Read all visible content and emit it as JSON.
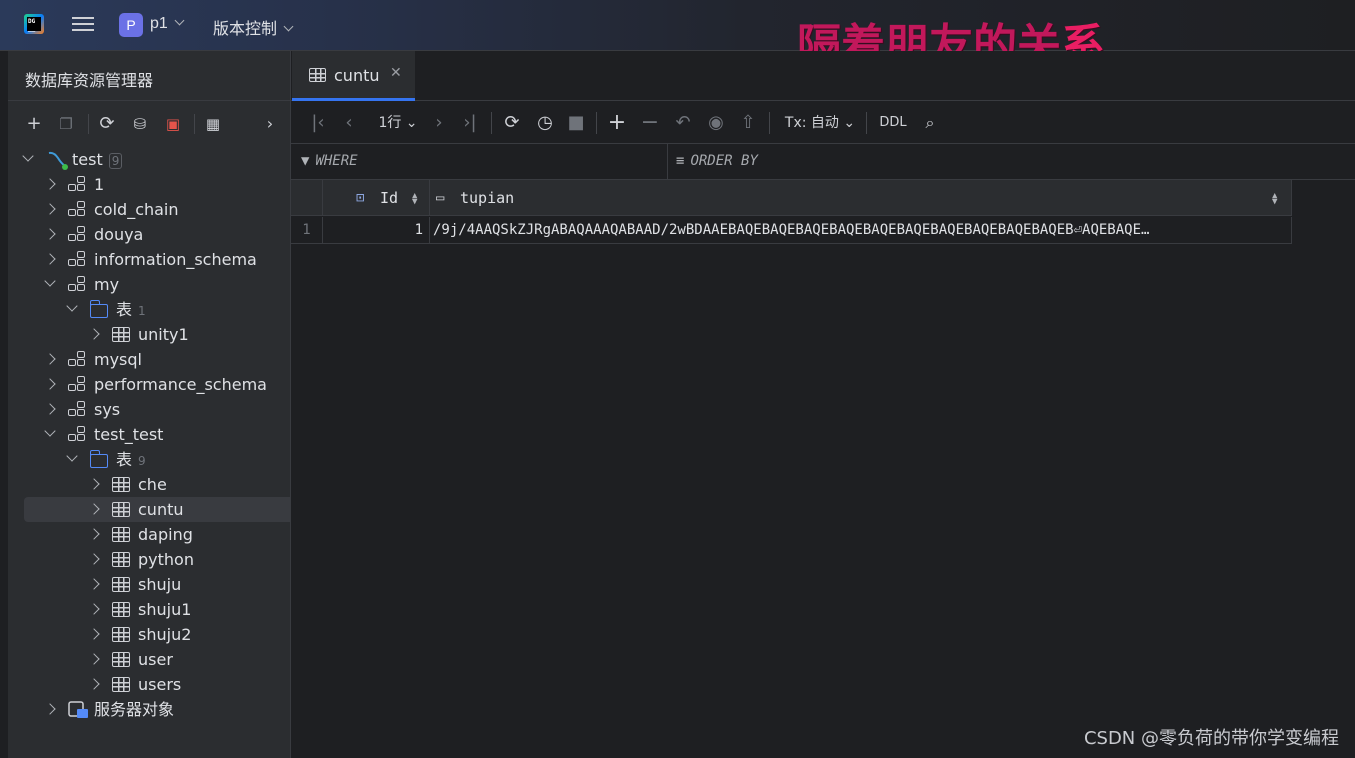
{
  "titlebar": {
    "project_badge": "P",
    "project_name": "p1",
    "vcs_label": "版本控制",
    "overlay_text_main": "隔着朋友的关",
    "overlay_text_last": "系"
  },
  "left_panel": {
    "title": "数据库资源管理器",
    "tree": [
      {
        "label": "test",
        "count": "9",
        "level": 0,
        "expanded": true,
        "icon": "datasource-icon"
      },
      {
        "label": "1",
        "level": 1,
        "expanded": false,
        "icon": "schema-icon"
      },
      {
        "label": "cold_chain",
        "level": 1,
        "expanded": false,
        "icon": "schema-icon"
      },
      {
        "label": "douya",
        "level": 1,
        "expanded": false,
        "icon": "schema-icon"
      },
      {
        "label": "information_schema",
        "level": 1,
        "expanded": false,
        "icon": "schema-icon"
      },
      {
        "label": "my",
        "level": 1,
        "expanded": true,
        "icon": "schema-icon"
      },
      {
        "label": "表",
        "count": "1",
        "level": 2,
        "expanded": true,
        "icon": "folder-icon"
      },
      {
        "label": "unity1",
        "level": 3,
        "expanded": false,
        "icon": "table-icon"
      },
      {
        "label": "mysql",
        "level": 1,
        "expanded": false,
        "icon": "schema-icon"
      },
      {
        "label": "performance_schema",
        "level": 1,
        "expanded": false,
        "icon": "schema-icon"
      },
      {
        "label": "sys",
        "level": 1,
        "expanded": false,
        "icon": "schema-icon"
      },
      {
        "label": "test_test",
        "level": 1,
        "expanded": true,
        "icon": "schema-icon"
      },
      {
        "label": "表",
        "count": "9",
        "level": 2,
        "expanded": true,
        "icon": "folder-icon"
      },
      {
        "label": "che",
        "level": 3,
        "expanded": false,
        "icon": "table-icon"
      },
      {
        "label": "cuntu",
        "level": 3,
        "expanded": false,
        "icon": "table-icon",
        "selected": true
      },
      {
        "label": "daping",
        "level": 3,
        "expanded": false,
        "icon": "table-icon"
      },
      {
        "label": "python",
        "level": 3,
        "expanded": false,
        "icon": "table-icon"
      },
      {
        "label": "shuju",
        "level": 3,
        "expanded": false,
        "icon": "table-icon"
      },
      {
        "label": "shuju1",
        "level": 3,
        "expanded": false,
        "icon": "table-icon"
      },
      {
        "label": "shuju2",
        "level": 3,
        "expanded": false,
        "icon": "table-icon"
      },
      {
        "label": "user",
        "level": 3,
        "expanded": false,
        "icon": "table-icon"
      },
      {
        "label": "users",
        "level": 3,
        "expanded": false,
        "icon": "table-icon"
      },
      {
        "label": "服务器对象",
        "level": 1,
        "expanded": false,
        "icon": "server-objects-icon"
      }
    ]
  },
  "editor": {
    "tab_label": "cuntu",
    "rows_selector": "1行",
    "tx_mode": "Tx: 自动",
    "ddl_label": "DDL",
    "where_label": "WHERE",
    "order_label": "ORDER BY",
    "columns": [
      "Id",
      "tupian"
    ],
    "rows": [
      {
        "num": "1",
        "id": "1",
        "tupian": "/9j/4AAQSkZJRgABAQAAAQABAAD/2wBDAAEBAQEBAQEBAQEBAQEBAQEBAQEBAQEBAQEBAQEBAQEB⏎AQEBAQE…"
      }
    ]
  },
  "watermark": "CSDN @零负荷的带你学变编程",
  "colors": {
    "accent": "#3574f0",
    "folder": "#548af7",
    "overlay": "#c2185b",
    "badge": "#6b71e6"
  }
}
